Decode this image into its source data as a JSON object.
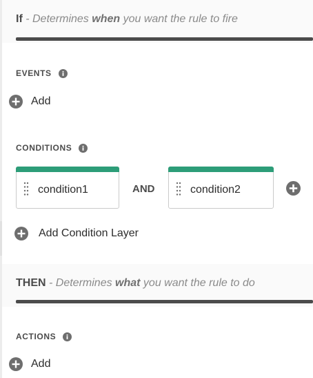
{
  "if_section": {
    "keyword": "If",
    "desc_pre": " - Determines ",
    "emph": "when",
    "desc_post": " you want the rule to fire"
  },
  "events": {
    "label": "EVENTS",
    "info_icon": "info-icon",
    "add_label": "Add"
  },
  "conditions": {
    "label": "CONDITIONS",
    "info_icon": "info-icon",
    "items": [
      {
        "name": "condition1"
      },
      {
        "name": "condition2"
      }
    ],
    "operator": "AND",
    "add_icon": "plus-circle-icon",
    "layer_label": "Add Condition Layer"
  },
  "then_section": {
    "keyword": "THEN",
    "desc_pre": " - Determines ",
    "emph": "what",
    "desc_post": " you want the rule to do"
  },
  "actions": {
    "label": "ACTIONS",
    "info_icon": "info-icon",
    "add_label": "Add"
  },
  "colors": {
    "accent_green": "#2d9d78",
    "rule_dark": "#4b4b4b",
    "icon_gray": "#6e6e6e"
  }
}
